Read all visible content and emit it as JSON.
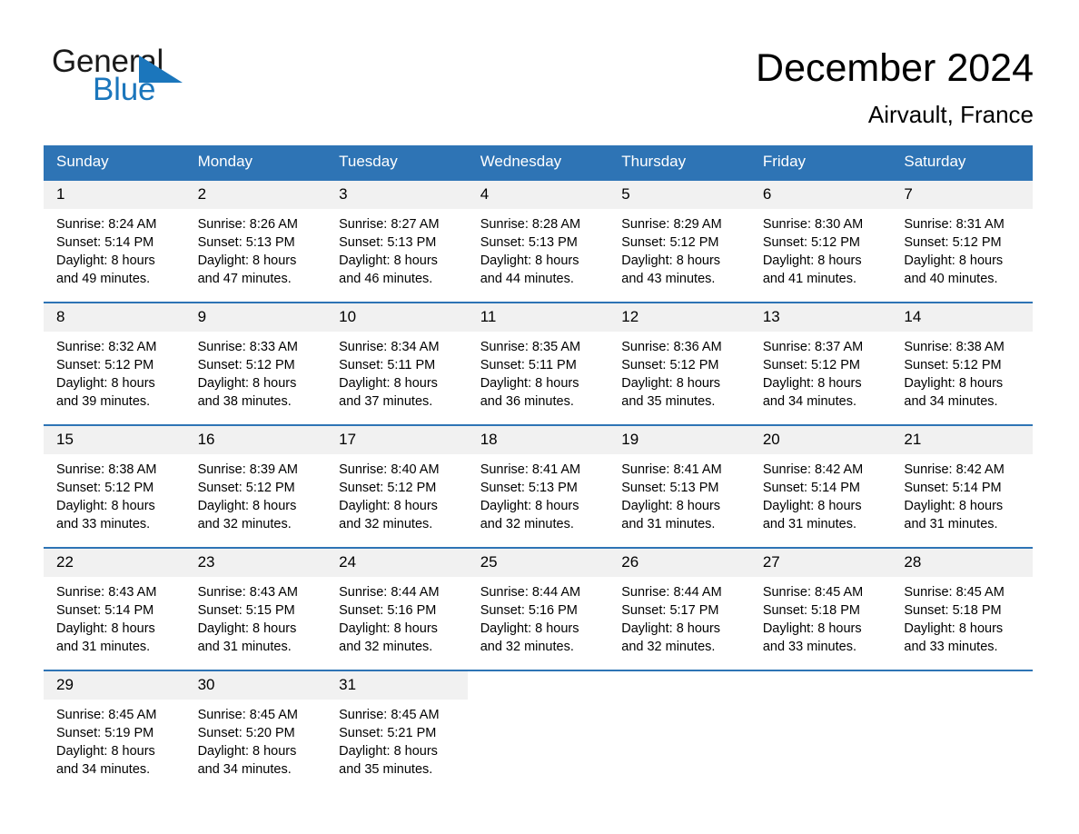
{
  "brand": {
    "name_top": "General",
    "name_bottom": "Blue",
    "triangle_icon": "blue-triangle-logo-mark",
    "color_top": "#1a1a1a",
    "color_bottom": "#1b76bc"
  },
  "header": {
    "title": "December 2024",
    "subtitle": "Airvault, France"
  },
  "theme": {
    "header_blue": "#2e74b5",
    "daynum_bg": "#f1f1f1",
    "page_bg": "#ffffff",
    "text": "#000000"
  },
  "calendar": {
    "weekday_headers": [
      "Sunday",
      "Monday",
      "Tuesday",
      "Wednesday",
      "Thursday",
      "Friday",
      "Saturday"
    ],
    "weeks": [
      [
        {
          "day": "1",
          "sunrise": "Sunrise: 8:24 AM",
          "sunset": "Sunset: 5:14 PM",
          "daylight_1": "Daylight: 8 hours",
          "daylight_2": "and 49 minutes."
        },
        {
          "day": "2",
          "sunrise": "Sunrise: 8:26 AM",
          "sunset": "Sunset: 5:13 PM",
          "daylight_1": "Daylight: 8 hours",
          "daylight_2": "and 47 minutes."
        },
        {
          "day": "3",
          "sunrise": "Sunrise: 8:27 AM",
          "sunset": "Sunset: 5:13 PM",
          "daylight_1": "Daylight: 8 hours",
          "daylight_2": "and 46 minutes."
        },
        {
          "day": "4",
          "sunrise": "Sunrise: 8:28 AM",
          "sunset": "Sunset: 5:13 PM",
          "daylight_1": "Daylight: 8 hours",
          "daylight_2": "and 44 minutes."
        },
        {
          "day": "5",
          "sunrise": "Sunrise: 8:29 AM",
          "sunset": "Sunset: 5:12 PM",
          "daylight_1": "Daylight: 8 hours",
          "daylight_2": "and 43 minutes."
        },
        {
          "day": "6",
          "sunrise": "Sunrise: 8:30 AM",
          "sunset": "Sunset: 5:12 PM",
          "daylight_1": "Daylight: 8 hours",
          "daylight_2": "and 41 minutes."
        },
        {
          "day": "7",
          "sunrise": "Sunrise: 8:31 AM",
          "sunset": "Sunset: 5:12 PM",
          "daylight_1": "Daylight: 8 hours",
          "daylight_2": "and 40 minutes."
        }
      ],
      [
        {
          "day": "8",
          "sunrise": "Sunrise: 8:32 AM",
          "sunset": "Sunset: 5:12 PM",
          "daylight_1": "Daylight: 8 hours",
          "daylight_2": "and 39 minutes."
        },
        {
          "day": "9",
          "sunrise": "Sunrise: 8:33 AM",
          "sunset": "Sunset: 5:12 PM",
          "daylight_1": "Daylight: 8 hours",
          "daylight_2": "and 38 minutes."
        },
        {
          "day": "10",
          "sunrise": "Sunrise: 8:34 AM",
          "sunset": "Sunset: 5:11 PM",
          "daylight_1": "Daylight: 8 hours",
          "daylight_2": "and 37 minutes."
        },
        {
          "day": "11",
          "sunrise": "Sunrise: 8:35 AM",
          "sunset": "Sunset: 5:11 PM",
          "daylight_1": "Daylight: 8 hours",
          "daylight_2": "and 36 minutes."
        },
        {
          "day": "12",
          "sunrise": "Sunrise: 8:36 AM",
          "sunset": "Sunset: 5:12 PM",
          "daylight_1": "Daylight: 8 hours",
          "daylight_2": "and 35 minutes."
        },
        {
          "day": "13",
          "sunrise": "Sunrise: 8:37 AM",
          "sunset": "Sunset: 5:12 PM",
          "daylight_1": "Daylight: 8 hours",
          "daylight_2": "and 34 minutes."
        },
        {
          "day": "14",
          "sunrise": "Sunrise: 8:38 AM",
          "sunset": "Sunset: 5:12 PM",
          "daylight_1": "Daylight: 8 hours",
          "daylight_2": "and 34 minutes."
        }
      ],
      [
        {
          "day": "15",
          "sunrise": "Sunrise: 8:38 AM",
          "sunset": "Sunset: 5:12 PM",
          "daylight_1": "Daylight: 8 hours",
          "daylight_2": "and 33 minutes."
        },
        {
          "day": "16",
          "sunrise": "Sunrise: 8:39 AM",
          "sunset": "Sunset: 5:12 PM",
          "daylight_1": "Daylight: 8 hours",
          "daylight_2": "and 32 minutes."
        },
        {
          "day": "17",
          "sunrise": "Sunrise: 8:40 AM",
          "sunset": "Sunset: 5:12 PM",
          "daylight_1": "Daylight: 8 hours",
          "daylight_2": "and 32 minutes."
        },
        {
          "day": "18",
          "sunrise": "Sunrise: 8:41 AM",
          "sunset": "Sunset: 5:13 PM",
          "daylight_1": "Daylight: 8 hours",
          "daylight_2": "and 32 minutes."
        },
        {
          "day": "19",
          "sunrise": "Sunrise: 8:41 AM",
          "sunset": "Sunset: 5:13 PM",
          "daylight_1": "Daylight: 8 hours",
          "daylight_2": "and 31 minutes."
        },
        {
          "day": "20",
          "sunrise": "Sunrise: 8:42 AM",
          "sunset": "Sunset: 5:14 PM",
          "daylight_1": "Daylight: 8 hours",
          "daylight_2": "and 31 minutes."
        },
        {
          "day": "21",
          "sunrise": "Sunrise: 8:42 AM",
          "sunset": "Sunset: 5:14 PM",
          "daylight_1": "Daylight: 8 hours",
          "daylight_2": "and 31 minutes."
        }
      ],
      [
        {
          "day": "22",
          "sunrise": "Sunrise: 8:43 AM",
          "sunset": "Sunset: 5:14 PM",
          "daylight_1": "Daylight: 8 hours",
          "daylight_2": "and 31 minutes."
        },
        {
          "day": "23",
          "sunrise": "Sunrise: 8:43 AM",
          "sunset": "Sunset: 5:15 PM",
          "daylight_1": "Daylight: 8 hours",
          "daylight_2": "and 31 minutes."
        },
        {
          "day": "24",
          "sunrise": "Sunrise: 8:44 AM",
          "sunset": "Sunset: 5:16 PM",
          "daylight_1": "Daylight: 8 hours",
          "daylight_2": "and 32 minutes."
        },
        {
          "day": "25",
          "sunrise": "Sunrise: 8:44 AM",
          "sunset": "Sunset: 5:16 PM",
          "daylight_1": "Daylight: 8 hours",
          "daylight_2": "and 32 minutes."
        },
        {
          "day": "26",
          "sunrise": "Sunrise: 8:44 AM",
          "sunset": "Sunset: 5:17 PM",
          "daylight_1": "Daylight: 8 hours",
          "daylight_2": "and 32 minutes."
        },
        {
          "day": "27",
          "sunrise": "Sunrise: 8:45 AM",
          "sunset": "Sunset: 5:18 PM",
          "daylight_1": "Daylight: 8 hours",
          "daylight_2": "and 33 minutes."
        },
        {
          "day": "28",
          "sunrise": "Sunrise: 8:45 AM",
          "sunset": "Sunset: 5:18 PM",
          "daylight_1": "Daylight: 8 hours",
          "daylight_2": "and 33 minutes."
        }
      ],
      [
        {
          "day": "29",
          "sunrise": "Sunrise: 8:45 AM",
          "sunset": "Sunset: 5:19 PM",
          "daylight_1": "Daylight: 8 hours",
          "daylight_2": "and 34 minutes."
        },
        {
          "day": "30",
          "sunrise": "Sunrise: 8:45 AM",
          "sunset": "Sunset: 5:20 PM",
          "daylight_1": "Daylight: 8 hours",
          "daylight_2": "and 34 minutes."
        },
        {
          "day": "31",
          "sunrise": "Sunrise: 8:45 AM",
          "sunset": "Sunset: 5:21 PM",
          "daylight_1": "Daylight: 8 hours",
          "daylight_2": "and 35 minutes."
        },
        {
          "day": "",
          "sunrise": "",
          "sunset": "",
          "daylight_1": "",
          "daylight_2": ""
        },
        {
          "day": "",
          "sunrise": "",
          "sunset": "",
          "daylight_1": "",
          "daylight_2": ""
        },
        {
          "day": "",
          "sunrise": "",
          "sunset": "",
          "daylight_1": "",
          "daylight_2": ""
        },
        {
          "day": "",
          "sunrise": "",
          "sunset": "",
          "daylight_1": "",
          "daylight_2": ""
        }
      ]
    ]
  }
}
